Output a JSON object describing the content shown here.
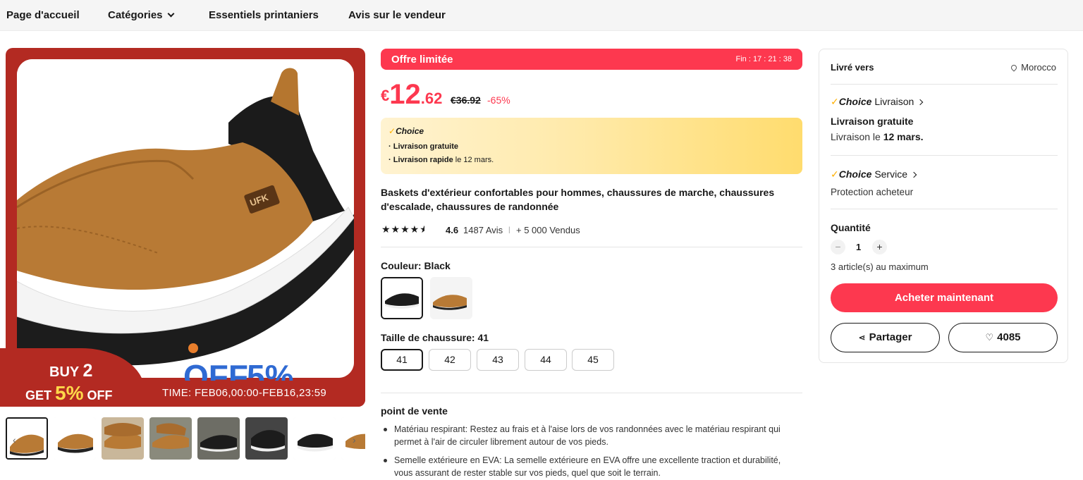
{
  "nav": {
    "home": "Page d'accueil",
    "categories": "Catégories",
    "spring": "Essentiels printaniers",
    "seller_reviews": "Avis sur le vendeur"
  },
  "gallery": {
    "promo_line1_prefix": "BUY",
    "promo_line1_num": "2",
    "promo_line2_prefix": "GET",
    "promo_line2_pct": "5%",
    "promo_line2_suffix": "OFF",
    "promo_time": "TIME:  FEB06,00:00-FEB16,23:59",
    "shoe_label": "UFK",
    "thumbnail_count": 8
  },
  "offer": {
    "label": "Offre limitée",
    "timer": "Fin : 17 : 21 : 38"
  },
  "price": {
    "currency": "€",
    "integer": "12",
    "decimal": ".62",
    "old": "€36.92",
    "discount": "-65%"
  },
  "choice_box": {
    "brand": "Choice",
    "line1": "· Livraison gratuite",
    "line2_bold": "· Livraison rapide",
    "line2_rest": " le 12 mars."
  },
  "product": {
    "title": "Baskets d'extérieur confortables pour hommes, chaussures de marche, chaussures d'escalade, chaussures de randonnée",
    "rating": "4.6",
    "reviews": "1487 Avis",
    "sold": "+ 5 000 Vendus"
  },
  "color": {
    "label": "Couleur: Black",
    "options": [
      "Black",
      "Brown"
    ]
  },
  "size": {
    "label": "Taille de chaussure: 41",
    "options": [
      "41",
      "42",
      "43",
      "44",
      "45"
    ],
    "selected": "41"
  },
  "selling_points": {
    "title": "point de vente",
    "items": [
      "Matériau respirant: Restez au frais et à l'aise lors de vos randonnées avec le matériau respirant qui permet à l'air de circuler librement autour de vos pieds.",
      "Semelle extérieure en EVA: La semelle extérieure en EVA offre une excellente traction et durabilité, vous assurant de rester stable sur vos pieds, quel que soit le terrain."
    ]
  },
  "panel": {
    "deliver_to": "Livré vers",
    "country": "Morocco",
    "choice_brand": "Choice",
    "livraison_link": "Livraison",
    "free_delivery": "Livraison gratuite",
    "delivery_prefix": "Livraison le ",
    "delivery_date": "12 mars.",
    "service_link": "Service",
    "buyer_protection": "Protection acheteur",
    "quantity_label": "Quantité",
    "quantity": "1",
    "max_note": "3 article(s) au maximum",
    "buy_now": "Acheter maintenant",
    "share": "Partager",
    "wishlist_count": "4085"
  },
  "colors": {
    "accent": "#fd384f",
    "choice_check": "#ffb000",
    "promo_red": "#b32a22"
  }
}
